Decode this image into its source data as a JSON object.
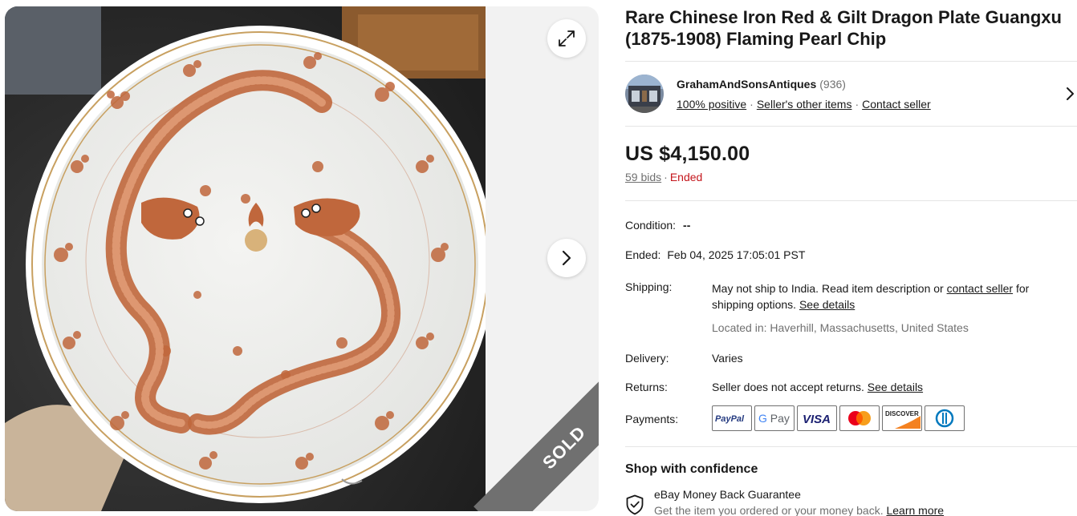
{
  "listing": {
    "title": "Rare Chinese Iron Red & Gilt Dragon Plate Guangxu (1875-1908) Flaming Pearl Chip"
  },
  "gallery": {
    "sold_label": "SOLD",
    "expand_icon": "expand-icon",
    "next_icon": "chevron-right-icon"
  },
  "seller": {
    "name": "GrahamAndSonsAntiques",
    "feedback_count": "(936)",
    "positive": "100% positive",
    "other_items": "Seller's other items",
    "contact": "Contact seller"
  },
  "price": {
    "amount": "US $4,150.00",
    "bids": "59 bids",
    "separator": "·",
    "status": "Ended"
  },
  "details": {
    "condition_label": "Condition:",
    "condition_value": "--",
    "ended_label": "Ended:",
    "ended_value": "Feb 04, 2025 17:05:01 PST",
    "shipping_label": "Shipping:",
    "shipping_text_1": "May not ship to India. Read item description or ",
    "shipping_link": "contact seller",
    "shipping_text_2": " for shipping options. ",
    "shipping_details": "See details",
    "location": "Located in: Haverhill, Massachusetts, United States",
    "delivery_label": "Delivery:",
    "delivery_value": "Varies",
    "returns_label": "Returns:",
    "returns_value": "Seller does not accept returns. ",
    "returns_details": "See details",
    "payments_label": "Payments:",
    "payment_methods": [
      "PayPal",
      "G Pay",
      "VISA",
      "Mastercard",
      "DISCOVER",
      "Diners Club"
    ]
  },
  "confidence": {
    "title": "Shop with confidence",
    "guarantee_title": "eBay Money Back Guarantee",
    "guarantee_sub": "Get the item you ordered or your money back. ",
    "learn_more": "Learn more"
  },
  "colors": {
    "ended": "#c4161c",
    "text": "#191919",
    "muted": "#707070",
    "iron_red": "#c0673c"
  }
}
